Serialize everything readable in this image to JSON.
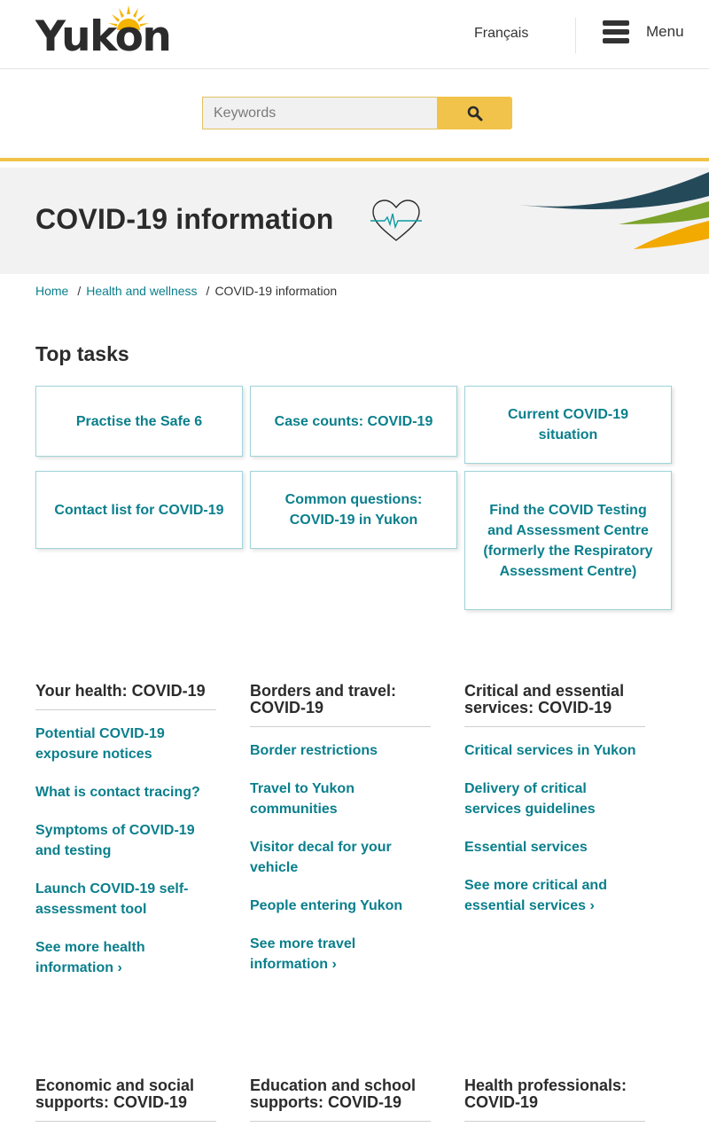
{
  "header": {
    "logo_text": "Yukon",
    "language_link": "Français",
    "menu_label": "Menu"
  },
  "search": {
    "placeholder": "Keywords"
  },
  "hero": {
    "title": "COVID-19 information"
  },
  "breadcrumb": {
    "home": "Home",
    "parent": "Health and wellness",
    "current": "COVID-19 information",
    "separator": "/"
  },
  "top_tasks": {
    "heading": "Top tasks",
    "cards": [
      "Practise the Safe 6",
      "Case counts: COVID-19",
      "Current COVID-19 situation",
      "Contact list for COVID-19",
      "Common questions: COVID-19 in Yukon",
      "Find the COVID Testing and Assessment Centre (formerly the Respiratory Assessment Centre)"
    ]
  },
  "columns": [
    {
      "title": "Your health: COVID-19",
      "links": [
        "Potential COVID-19 exposure notices",
        "What is contact tracing?",
        "Symptoms of COVID-19 and testing",
        "Launch COVID-19 self-assessment tool",
        "See more health information ›"
      ]
    },
    {
      "title": "Borders and travel: COVID-19",
      "links": [
        "Border restrictions",
        "Travel to Yukon communities",
        "Visitor decal for your vehicle",
        "People entering Yukon",
        "See more travel information ›"
      ]
    },
    {
      "title": "Critical and essential services: COVID-19",
      "links": [
        "Critical services in Yukon",
        "Delivery of critical services guidelines",
        "Essential services",
        "See more critical and essential services ›"
      ]
    },
    {
      "title": "Economic and social supports: COVID-19",
      "links": []
    },
    {
      "title": "Education and school supports: COVID-19",
      "links": []
    },
    {
      "title": "Health professionals: COVID-19",
      "links": []
    }
  ],
  "colors": {
    "link": "#0a7f8c",
    "accent_yellow": "#f2c34a",
    "card_border": "#9fd3d8",
    "hero_bg": "#f2f2f2"
  }
}
